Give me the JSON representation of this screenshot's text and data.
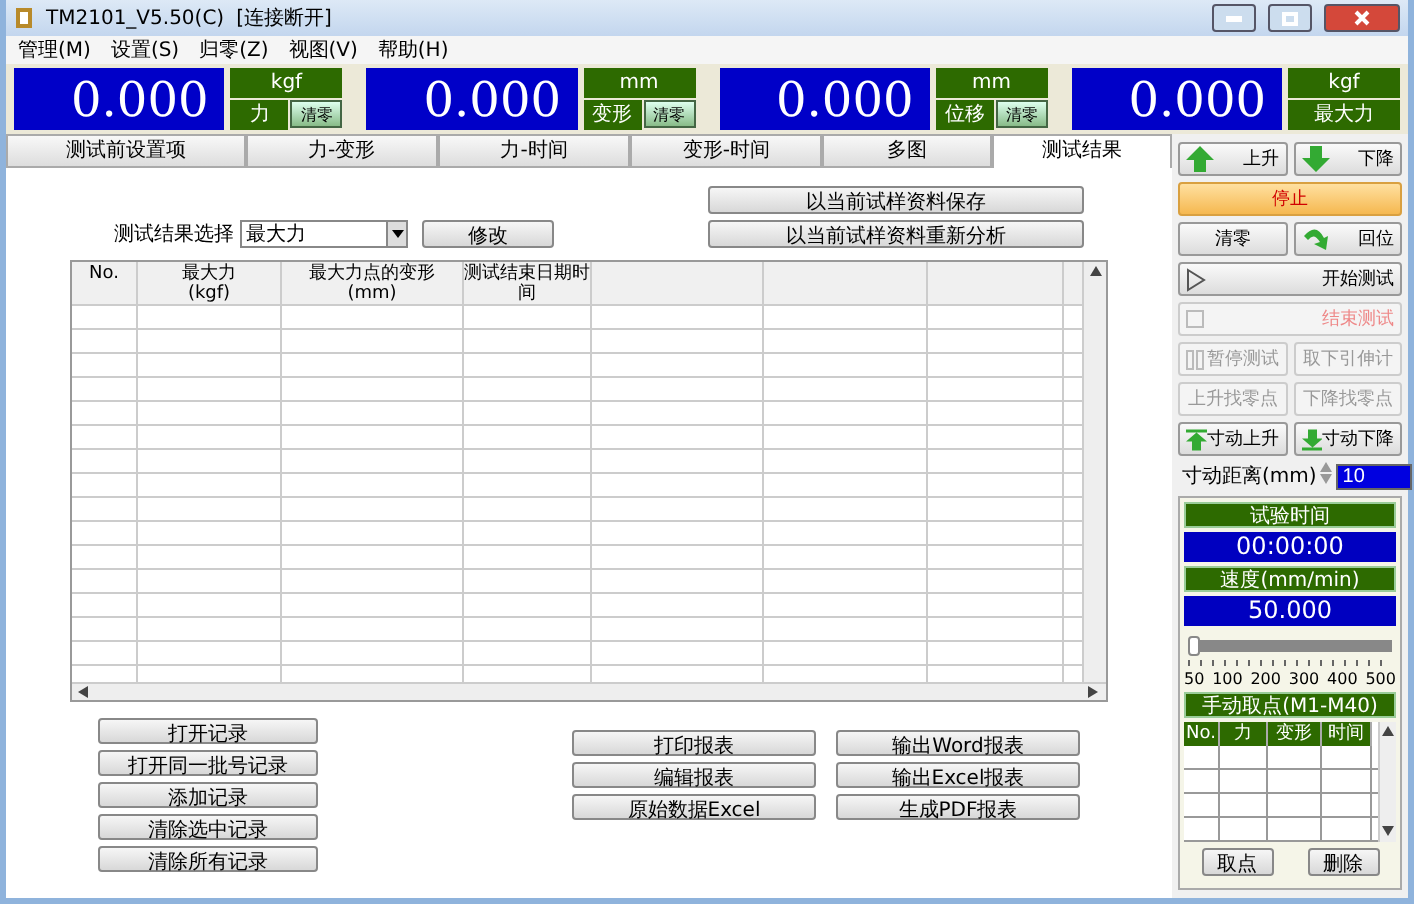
{
  "window": {
    "title": "TM2101_V5.50(C)",
    "status": "[连接断开]"
  },
  "menu": [
    "管理(M)",
    "设置(S)",
    "归零(Z)",
    "视图(V)",
    "帮助(H)"
  ],
  "readouts": [
    {
      "value": "0.000",
      "unit": "kgf",
      "label": "力",
      "zero_button": "清零"
    },
    {
      "value": "0.000",
      "unit": "mm",
      "label": "变形",
      "zero_button": "清零"
    },
    {
      "value": "0.000",
      "unit": "mm",
      "label": "位移",
      "zero_button": "清零"
    },
    {
      "value": "0.000",
      "unit": "kgf",
      "label": "最大力"
    }
  ],
  "tabs": [
    {
      "label": "测试前设置项",
      "selected": false
    },
    {
      "label": "力-变形",
      "selected": false
    },
    {
      "label": "力-时间",
      "selected": false
    },
    {
      "label": "变形-时间",
      "selected": false
    },
    {
      "label": "多图",
      "selected": false
    },
    {
      "label": "测试结果",
      "selected": true
    }
  ],
  "results": {
    "select_label": "测试结果选择",
    "select_value": "最大力",
    "modify_button": "修改",
    "save_button": "以当前试样资料保存",
    "reanalyze_button": "以当前试样资料重新分析",
    "columns": [
      {
        "title": "No."
      },
      {
        "title": "最大力",
        "unit": "(kgf)"
      },
      {
        "title": "最大力点的变形",
        "unit": "(mm)"
      },
      {
        "title": "测试结束日期时间"
      },
      {},
      {},
      {}
    ]
  },
  "record_buttons": [
    "打开记录",
    "打开同一批号记录",
    "添加记录",
    "清除选中记录",
    "清除所有记录"
  ],
  "report_buttons": [
    "打印报表",
    "输出Word报表",
    "编辑报表",
    "输出Excel报表",
    "原始数据Excel",
    "生成PDF报表"
  ],
  "controls": [
    [
      {
        "label": "上升",
        "kind": "up",
        "disabled": false
      },
      {
        "label": "下降",
        "kind": "down",
        "disabled": false
      }
    ],
    [
      {
        "label": "停止",
        "kind": "stop",
        "disabled": false
      }
    ],
    [
      {
        "label": "清零",
        "kind": "plain",
        "disabled": false
      },
      {
        "label": "回位",
        "kind": "return",
        "disabled": false
      }
    ],
    [
      {
        "label": "开始测试",
        "kind": "play",
        "disabled": false
      }
    ],
    [
      {
        "label": "结束测试",
        "kind": "end",
        "disabled": true
      }
    ],
    [
      {
        "label": "暂停测试",
        "kind": "pause",
        "disabled": true
      },
      {
        "label": "取下引伸计",
        "kind": "plain",
        "disabled": true
      }
    ],
    [
      {
        "label": "上升找零点",
        "kind": "plain",
        "disabled": true
      },
      {
        "label": "下降找零点",
        "kind": "plain",
        "disabled": true
      }
    ],
    [
      {
        "label": "寸动上升",
        "kind": "jogup",
        "disabled": false
      },
      {
        "label": "寸动下降",
        "kind": "jogdown",
        "disabled": false
      }
    ]
  ],
  "jog": {
    "label": "寸动距离(mm)",
    "value": "10"
  },
  "test_time": {
    "label": "试验时间",
    "value": "00:00:00"
  },
  "speed": {
    "label": "速度(mm/min)",
    "value": "50.000",
    "level": 0,
    "ticks": [
      "50",
      "100",
      "200",
      "300",
      "400",
      "500"
    ]
  },
  "manual_points": {
    "title": "手动取点(M1-M40)",
    "columns": [
      "No.",
      "力",
      "变形",
      "时间"
    ],
    "buttons": [
      "取点",
      "删除"
    ]
  }
}
